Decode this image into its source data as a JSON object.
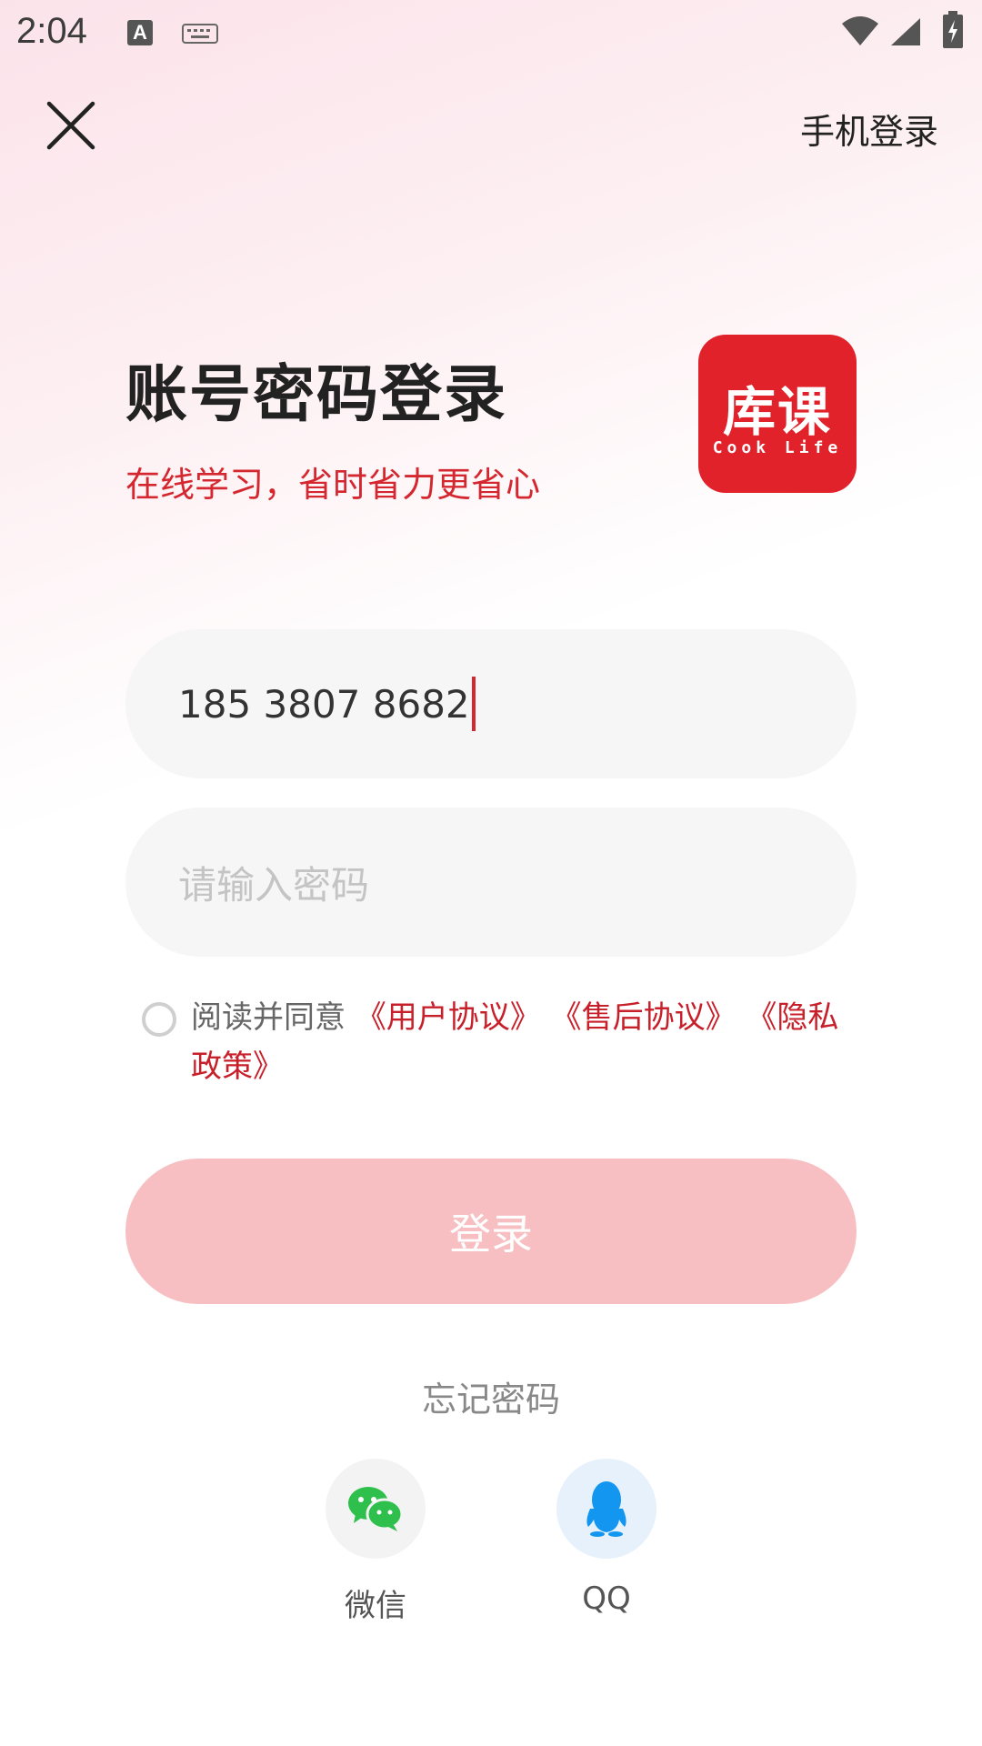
{
  "status_bar": {
    "time": "2:04",
    "keyboard_letter": "A"
  },
  "nav": {
    "phone_login": "手机登录"
  },
  "header": {
    "title": "账号密码登录",
    "subtitle": "在线学习，省时省力更省心",
    "logo_main": "库课",
    "logo_sub": "Cook Life"
  },
  "form": {
    "phone_value": "185 3807 8682",
    "password_placeholder": "请输入密码"
  },
  "agreement": {
    "prefix": "阅读并同意",
    "links": [
      "《用户协议》",
      "《售后协议》",
      "《隐私政策》"
    ]
  },
  "login_button": "登录",
  "forgot_password": "忘记密码",
  "third_party": {
    "wechat": "微信",
    "qq": "QQ"
  },
  "colors": {
    "brand_red": "#e1222a",
    "button_pink": "#f7bfc2",
    "link_red": "#c8202a",
    "wechat_green": "#2fbf4c",
    "qq_blue": "#1296f0"
  },
  "icons": [
    "close-icon",
    "wechat-icon",
    "qq-icon",
    "wifi-icon",
    "signal-icon",
    "battery-icon",
    "keyboard-icon"
  ]
}
